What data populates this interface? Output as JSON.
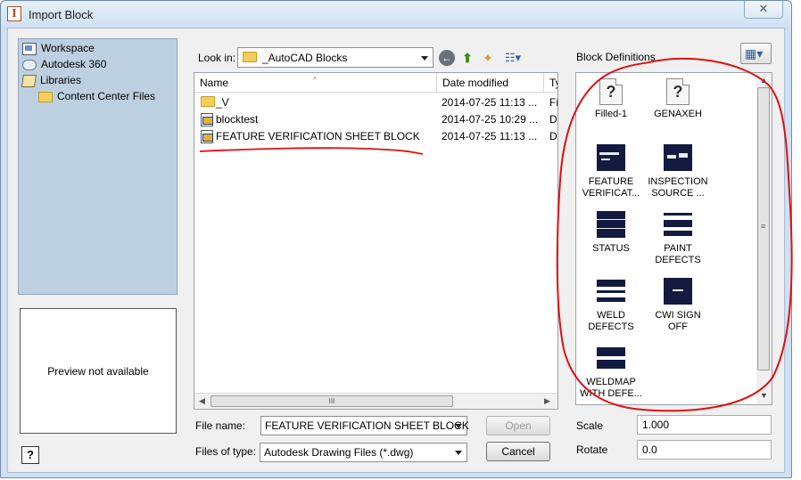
{
  "window": {
    "title": "Import Block",
    "close_glyph": "✕"
  },
  "places": {
    "items": [
      {
        "label": "Workspace",
        "icon": "workspace-icon"
      },
      {
        "label": "Autodesk 360",
        "icon": "cloud-icon"
      },
      {
        "label": "Libraries",
        "icon": "library-icon"
      },
      {
        "label": "Content Center Files",
        "icon": "folder-icon"
      }
    ]
  },
  "preview": {
    "text": "Preview not available"
  },
  "help": {
    "glyph": "?"
  },
  "look_in": {
    "label": "Look in:",
    "value": "_AutoCAD Blocks"
  },
  "toolbar": {
    "back": "←",
    "up": "⬆",
    "new_folder": "✦",
    "view": "☷▾"
  },
  "file_list": {
    "columns": [
      "Name",
      "Date modified",
      "Ty"
    ],
    "sort_caret": "^",
    "rows": [
      {
        "name": "_V",
        "date": "2014-07-25 11:13 ...",
        "type": "Fi",
        "kind": "folder"
      },
      {
        "name": "blocktest",
        "date": "2014-07-25 10:29 ...",
        "type": "D\\",
        "kind": "dwg"
      },
      {
        "name": "FEATURE VERIFICATION SHEET BLOCK",
        "date": "2014-07-25 11:13 ...",
        "type": "D\\",
        "kind": "dwg"
      }
    ],
    "hscroll_grip": "III"
  },
  "block_definitions": {
    "label": "Block Definitions",
    "view_glyph": "▦▾",
    "items": [
      {
        "line1": "Filled-1",
        "line2": "",
        "thumb": "unknown"
      },
      {
        "line1": "GENAXEH",
        "line2": "",
        "thumb": "unknown"
      },
      {
        "line1": "FEATURE",
        "line2": "VERIFICAT...",
        "thumb": "dark"
      },
      {
        "line1": "INSPECTION",
        "line2": "SOURCE ...",
        "thumb": "dark"
      },
      {
        "line1": "STATUS",
        "line2": "",
        "thumb": "dark"
      },
      {
        "line1": "PAINT",
        "line2": "DEFECTS",
        "thumb": "dark"
      },
      {
        "line1": "WELD",
        "line2": "DEFECTS",
        "thumb": "dark"
      },
      {
        "line1": "CWI SIGN OFF",
        "line2": "",
        "thumb": "dark"
      },
      {
        "line1": "WELDMAP",
        "line2": "WITH DEFE...",
        "thumb": "dark"
      }
    ]
  },
  "form": {
    "file_name_label": "File name:",
    "file_name_value": "FEATURE VERIFICATION SHEET BLOCK",
    "files_of_type_label": "Files of type:",
    "files_of_type_value": "Autodesk Drawing Files (*.dwg)",
    "open_label": "Open",
    "cancel_label": "Cancel",
    "scale_label": "Scale",
    "scale_value": "1.000",
    "rotate_label": "Rotate",
    "rotate_value": "0.0"
  },
  "colors": {
    "annotation_red": "#e01010",
    "block_thumb": "#121a3f",
    "places_bg": "#bcd0e2"
  }
}
